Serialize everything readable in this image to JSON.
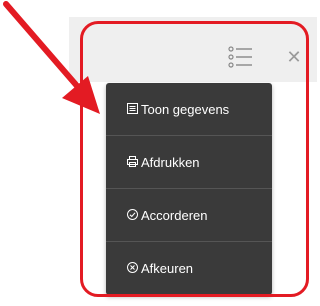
{
  "header": {
    "menu_icon": "list-icon",
    "close_icon": "close-icon",
    "close_glyph": "✕"
  },
  "menu": {
    "items": [
      {
        "label": "Toon gegevens",
        "icon": "document-list-icon"
      },
      {
        "label": "Afdrukken",
        "icon": "print-icon"
      },
      {
        "label": "Accorderen",
        "icon": "check-circle-icon"
      },
      {
        "label": "Afkeuren",
        "icon": "x-circle-icon"
      }
    ]
  },
  "colors": {
    "highlight": "#e31b23",
    "menu_bg": "#3a3a3a",
    "panel_bg": "#efefef"
  }
}
